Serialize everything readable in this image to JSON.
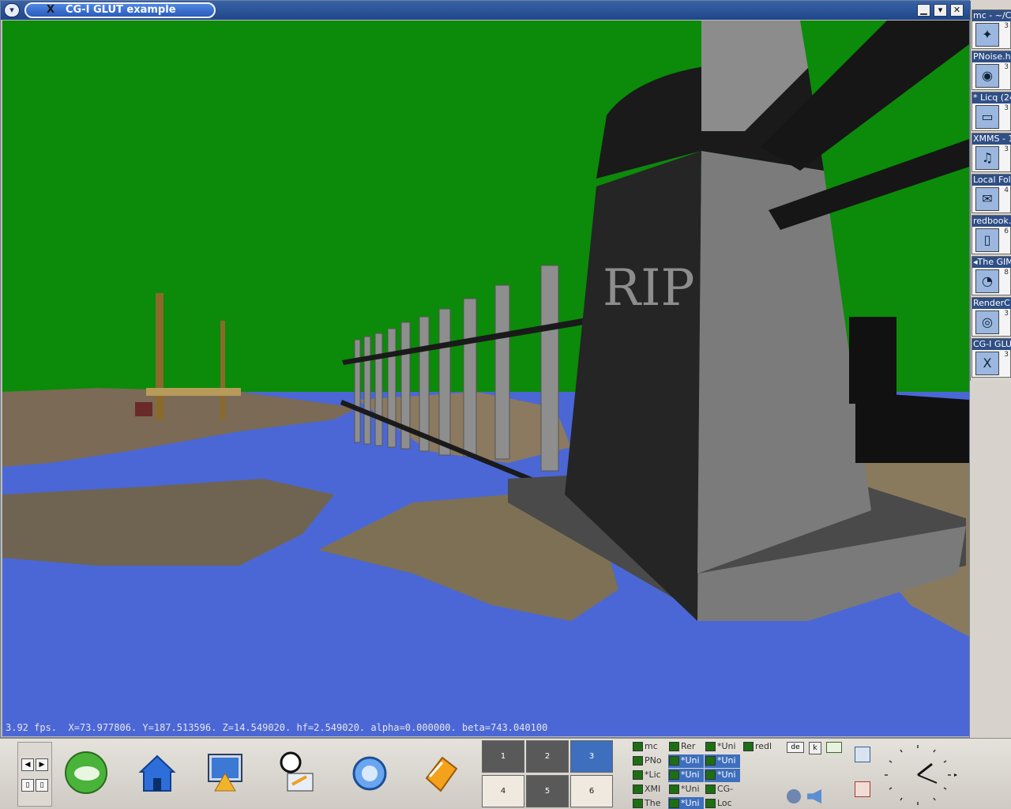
{
  "window": {
    "title": "CG-I GLUT example",
    "menu_glyph": "▾",
    "icon_glyph": "X",
    "buttons": [
      "▁",
      "▾",
      "✕"
    ]
  },
  "scene": {
    "sky_color": "#0c8a09",
    "water_color": "#4b67d6",
    "stone_color": "#6a6a6a",
    "engraving": "RIP"
  },
  "status": {
    "fps_line": "3.92 fps.  X=73.977806. Y=187.513596. Z=14.549020. hf=2.549020. alpha=0.000000. beta=743.040100"
  },
  "pager": {
    "items": [
      {
        "label": "mc - ~/C(",
        "num": "3",
        "icon": "✦"
      },
      {
        "label": "PNoise.h:",
        "num": "3",
        "icon": "◉"
      },
      {
        "label": "* Licq (24",
        "num": "3",
        "icon": "▭"
      },
      {
        "label": "XMMS - 1",
        "num": "3",
        "icon": "♫"
      },
      {
        "label": "Local Fol",
        "num": "4",
        "icon": "✉"
      },
      {
        "label": "redbook.",
        "num": "6",
        "icon": "▯"
      },
      {
        "label": "◂The GIM",
        "num": "8",
        "icon": "◔"
      },
      {
        "label": "RenderC",
        "num": "3",
        "icon": "◎"
      },
      {
        "label": "CG-I GLU",
        "num": "3",
        "icon": "X"
      }
    ]
  },
  "panel": {
    "desktops": [
      {
        "label": "1",
        "active": false,
        "dark": true
      },
      {
        "label": "2",
        "active": false,
        "dark": true
      },
      {
        "label": "3",
        "active": true,
        "dark": false
      },
      {
        "label": "4",
        "active": false,
        "dark": false
      },
      {
        "label": "5",
        "active": false,
        "dark": true
      },
      {
        "label": "6",
        "active": false,
        "dark": false
      }
    ],
    "tasks": [
      {
        "label": "mc",
        "sel": false
      },
      {
        "label": "Rer",
        "sel": false
      },
      {
        "label": "*Uni",
        "sel": false
      },
      {
        "label": "redl",
        "sel": false
      },
      {
        "label": "PNo",
        "sel": false
      },
      {
        "label": "*Uni",
        "sel": true
      },
      {
        "label": "*Uni",
        "sel": true
      },
      {
        "label": "*Lic",
        "sel": false
      },
      {
        "label": "*Uni",
        "sel": true
      },
      {
        "label": "*Uni",
        "sel": true
      },
      {
        "label": "XMI",
        "sel": false
      },
      {
        "label": "*Uni",
        "sel": false
      },
      {
        "label": "CG-",
        "sel": false
      },
      {
        "label": "The",
        "sel": false
      },
      {
        "label": "*Uni",
        "sel": true
      },
      {
        "label": "Loc",
        "sel": false
      }
    ],
    "tray_flag": "de",
    "tray_k": "k"
  }
}
